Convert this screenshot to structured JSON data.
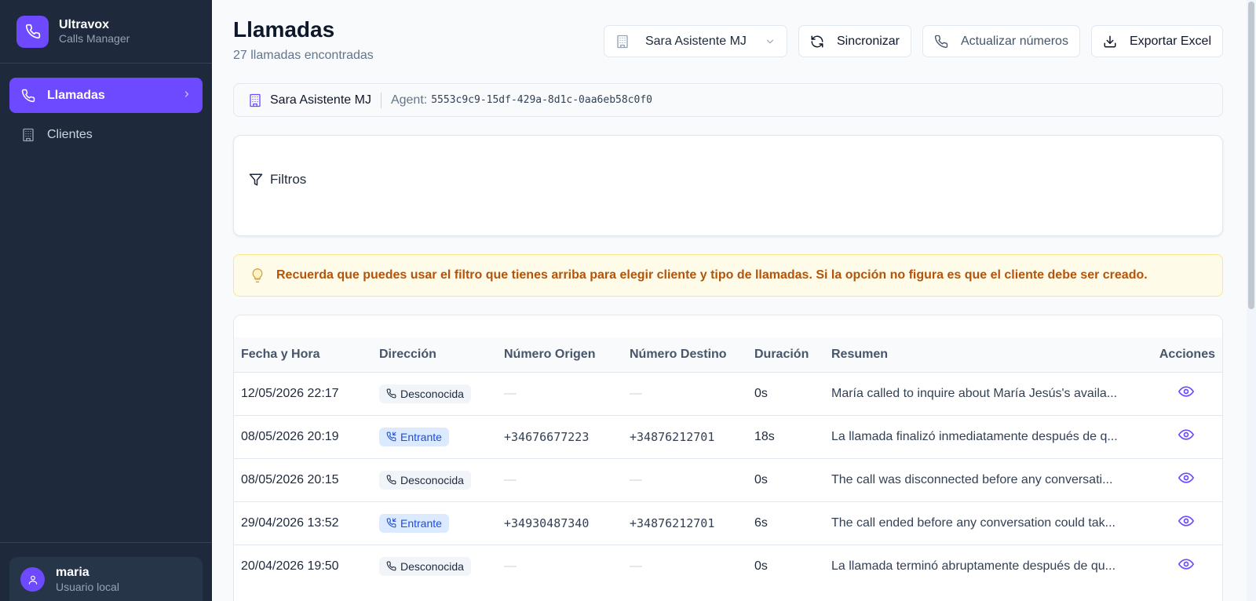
{
  "sidebar": {
    "brand_title": "Ultravox",
    "brand_subtitle": "Calls Manager",
    "items": [
      {
        "label": "Llamadas"
      },
      {
        "label": "Clientes"
      }
    ],
    "user": {
      "name": "maria",
      "role": "Usuario local"
    }
  },
  "header": {
    "title": "Llamadas",
    "subtitle": "27 llamadas encontradas"
  },
  "toolbar": {
    "client_select": "Sara Asistente MJ",
    "sync_label": "Sincronizar",
    "update_numbers_label": "Actualizar números",
    "export_label": "Exportar Excel"
  },
  "agent": {
    "name": "Sara Asistente MJ",
    "label": "Agent:",
    "id": "5553c9c9-15df-429a-8d1c-0aa6eb58c0f0"
  },
  "filters": {
    "label": "Filtros"
  },
  "tip": {
    "text": "Recuerda que puedes usar el filtro que tienes arriba para elegir cliente y tipo de llamadas. Si la opción no figura es que el cliente debe ser creado."
  },
  "table": {
    "columns": [
      "Fecha y Hora",
      "Dirección",
      "Número Origen",
      "Número Destino",
      "Duración",
      "Resumen",
      "Acciones"
    ],
    "rows": [
      {
        "fecha": "12/05/2026 22:17",
        "direccion": "Desconocida",
        "origen": "—",
        "destino": "—",
        "duracion": "0s",
        "resumen": "María called to inquire about María Jesús's availa..."
      },
      {
        "fecha": "08/05/2026 20:19",
        "direccion": "Entrante",
        "origen": "+34676677223",
        "destino": "+34876212701",
        "duracion": "18s",
        "resumen": "La llamada finalizó inmediatamente después de q..."
      },
      {
        "fecha": "08/05/2026 20:15",
        "direccion": "Desconocida",
        "origen": "—",
        "destino": "—",
        "duracion": "0s",
        "resumen": "The call was disconnected before any conversati..."
      },
      {
        "fecha": "29/04/2026 13:52",
        "direccion": "Entrante",
        "origen": "+34930487340",
        "destino": "+34876212701",
        "duracion": "6s",
        "resumen": "The call ended before any conversation could tak..."
      },
      {
        "fecha": "20/04/2026 19:50",
        "direccion": "Desconocida",
        "origen": "—",
        "destino": "—",
        "duracion": "0s",
        "resumen": "La llamada terminó abruptamente después de qu..."
      }
    ]
  },
  "colors": {
    "accent": "#6d4aff",
    "sidebar_bg": "#1e293b",
    "tip_text": "#b45309",
    "incoming_badge": "#1d4ed8"
  },
  "icons": {
    "brand": "phone-icon",
    "nav_llamadas": "phone-icon",
    "nav_clientes": "building-icon",
    "user": "user-icon",
    "sync": "refresh-icon",
    "update": "phone-icon",
    "export": "download-icon",
    "filters": "filter-icon",
    "tip": "lightbulb-icon",
    "row_action": "eye-icon"
  }
}
